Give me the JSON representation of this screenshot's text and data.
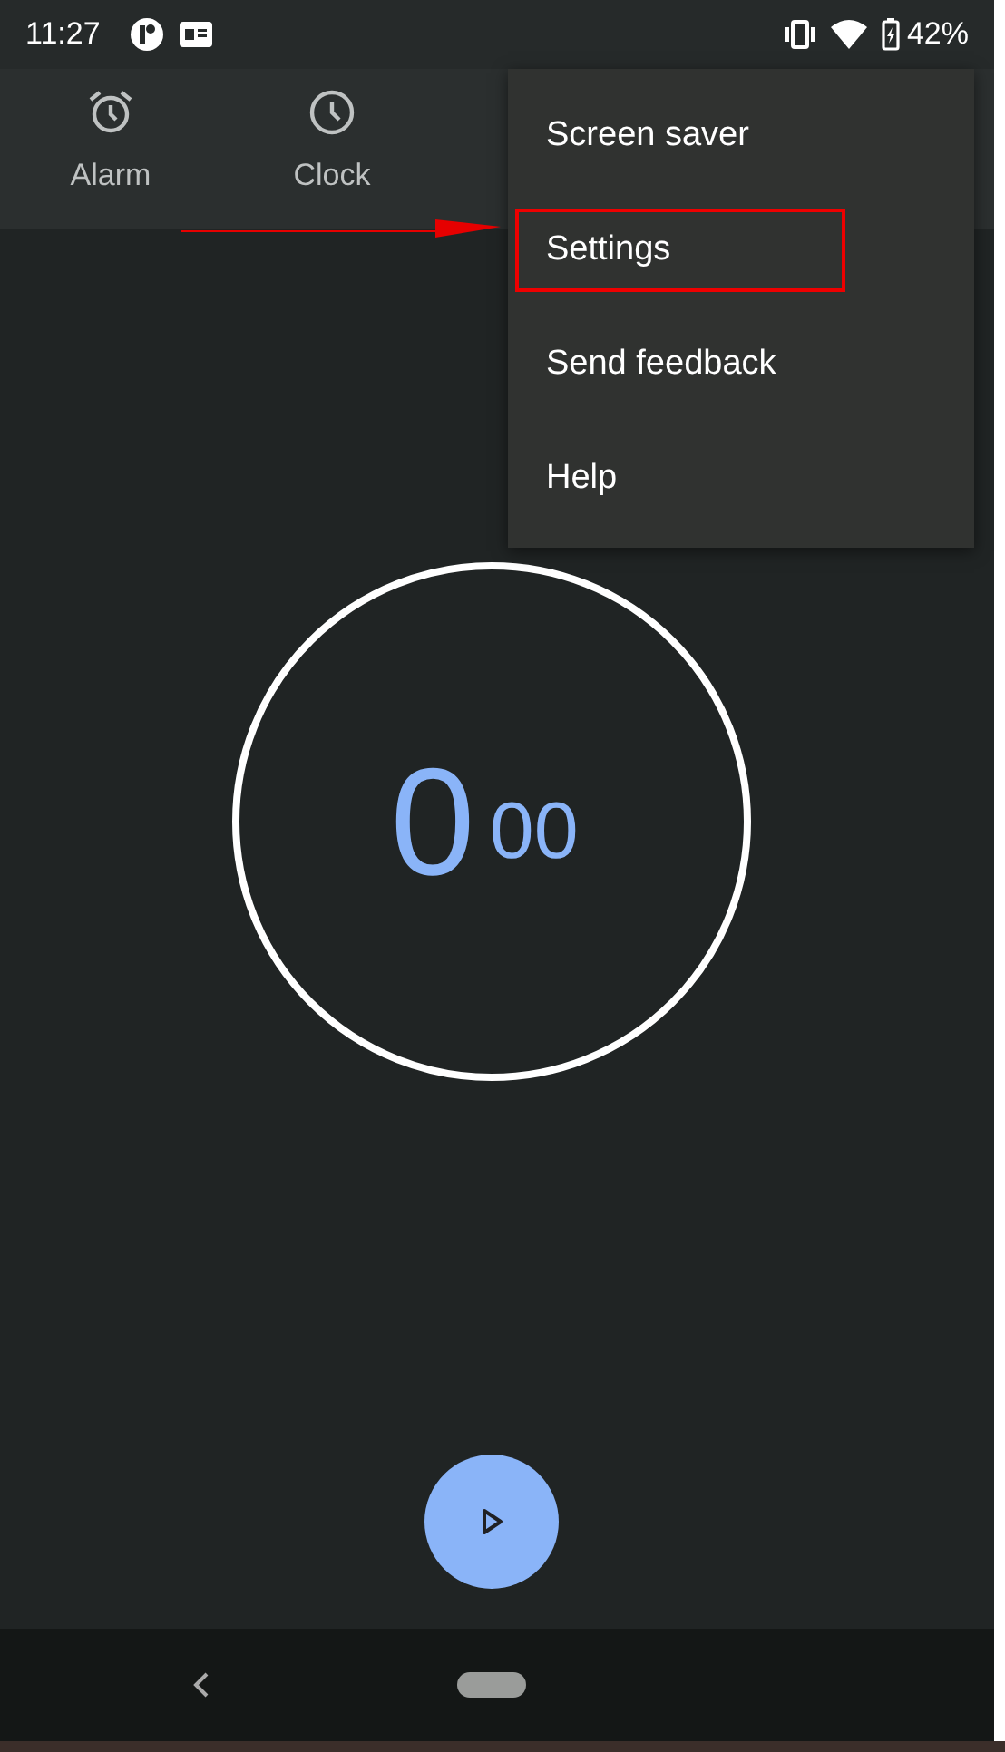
{
  "status_bar": {
    "time": "11:27",
    "battery": "42%"
  },
  "tabs": [
    {
      "label": "Alarm",
      "kind": "alarm",
      "selected": false
    },
    {
      "label": "Clock",
      "kind": "clock",
      "selected": false
    }
  ],
  "menu": {
    "items": [
      {
        "label": "Screen saver",
        "highlighted": false
      },
      {
        "label": "Settings",
        "highlighted": true
      },
      {
        "label": "Send feedback",
        "highlighted": false
      },
      {
        "label": "Help",
        "highlighted": false
      }
    ]
  },
  "timer": {
    "seconds": "0",
    "hundredths": "00"
  }
}
